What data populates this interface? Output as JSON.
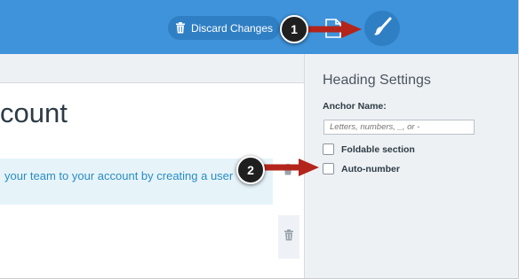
{
  "toolbar": {
    "discard_label": "Discard Changes"
  },
  "editor": {
    "heading": "count",
    "highlight_text": "your team to your account by creating a user"
  },
  "panel": {
    "title": "Heading Settings",
    "anchor_label": "Anchor Name:",
    "anchor_placeholder": "Letters, numbers, _, or -",
    "foldable_label": "Foldable section",
    "autonumber_label": "Auto-number"
  },
  "annotations": {
    "callout1": "1",
    "callout2": "2"
  },
  "colors": {
    "topbar": "#3e93db",
    "button": "#2f7fc5",
    "panel": "#eef1f4",
    "arrow": "#b3251b",
    "link": "#2a8bc3"
  },
  "icons": [
    "trash-icon",
    "document-icon",
    "brush-icon"
  ]
}
